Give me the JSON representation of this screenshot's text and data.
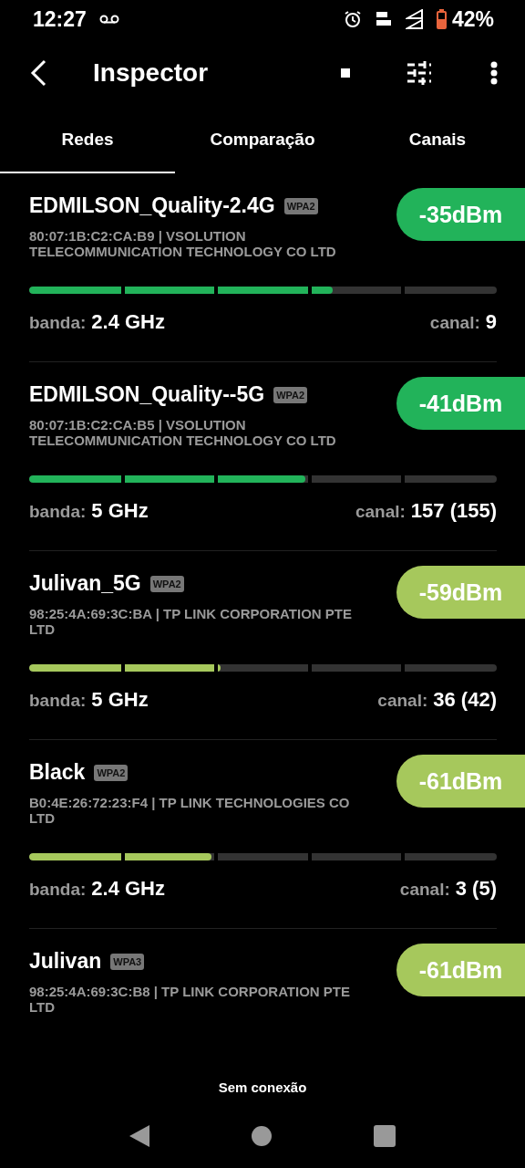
{
  "status_bar": {
    "time": "12:27",
    "battery": "42%"
  },
  "toolbar": {
    "title": "Inspector"
  },
  "tabs": [
    {
      "label": "Redes",
      "selected": true
    },
    {
      "label": "Comparação",
      "selected": false
    },
    {
      "label": "Canais",
      "selected": false
    }
  ],
  "networks": [
    {
      "ssid": "EDMILSON_Quality-2.4G",
      "security": "WPA2",
      "signal": "-35dBm",
      "color": "#22b35a",
      "details": "80:07:1B:C2:CA:B9  | VSOLUTION TELECOMMUNICATION TECHNOLOGY CO LTD",
      "level": 0.65,
      "band_label": "banda:",
      "band": "2.4 GHz",
      "channel_label": "canal:",
      "channel": "9"
    },
    {
      "ssid": "EDMILSON_Quality--5G",
      "security": "WPA2",
      "signal": "-41dBm",
      "color": "#22b35a",
      "details": "80:07:1B:C2:CA:B5  | VSOLUTION TELECOMMUNICATION TECHNOLOGY CO LTD",
      "level": 0.59,
      "band_label": "banda:",
      "band": "5 GHz",
      "channel_label": "canal:",
      "channel": "157 (155)"
    },
    {
      "ssid": "Julivan_5G",
      "security": "WPA2",
      "signal": "-59dBm",
      "color": "#a6c85c",
      "details": "98:25:4A:69:3C:BA  | TP LINK CORPORATION PTE LTD",
      "level": 0.41,
      "band_label": "banda:",
      "band": "5 GHz",
      "channel_label": "canal:",
      "channel": "36 (42)"
    },
    {
      "ssid": "Black",
      "security": "WPA2",
      "signal": "-61dBm",
      "color": "#a6c85c",
      "details": "B0:4E:26:72:23:F4  | TP LINK TECHNOLOGIES CO LTD",
      "level": 0.39,
      "band_label": "banda:",
      "band": "2.4 GHz",
      "channel_label": "canal:",
      "channel": "3 (5)"
    },
    {
      "ssid": "Julivan",
      "security": "WPA3",
      "signal": "-61dBm",
      "color": "#a6c85c",
      "details": "98:25:4A:69:3C:B8  | TP LINK CORPORATION PTE LTD"
    }
  ],
  "footer": {
    "status": "Sem conexão"
  }
}
